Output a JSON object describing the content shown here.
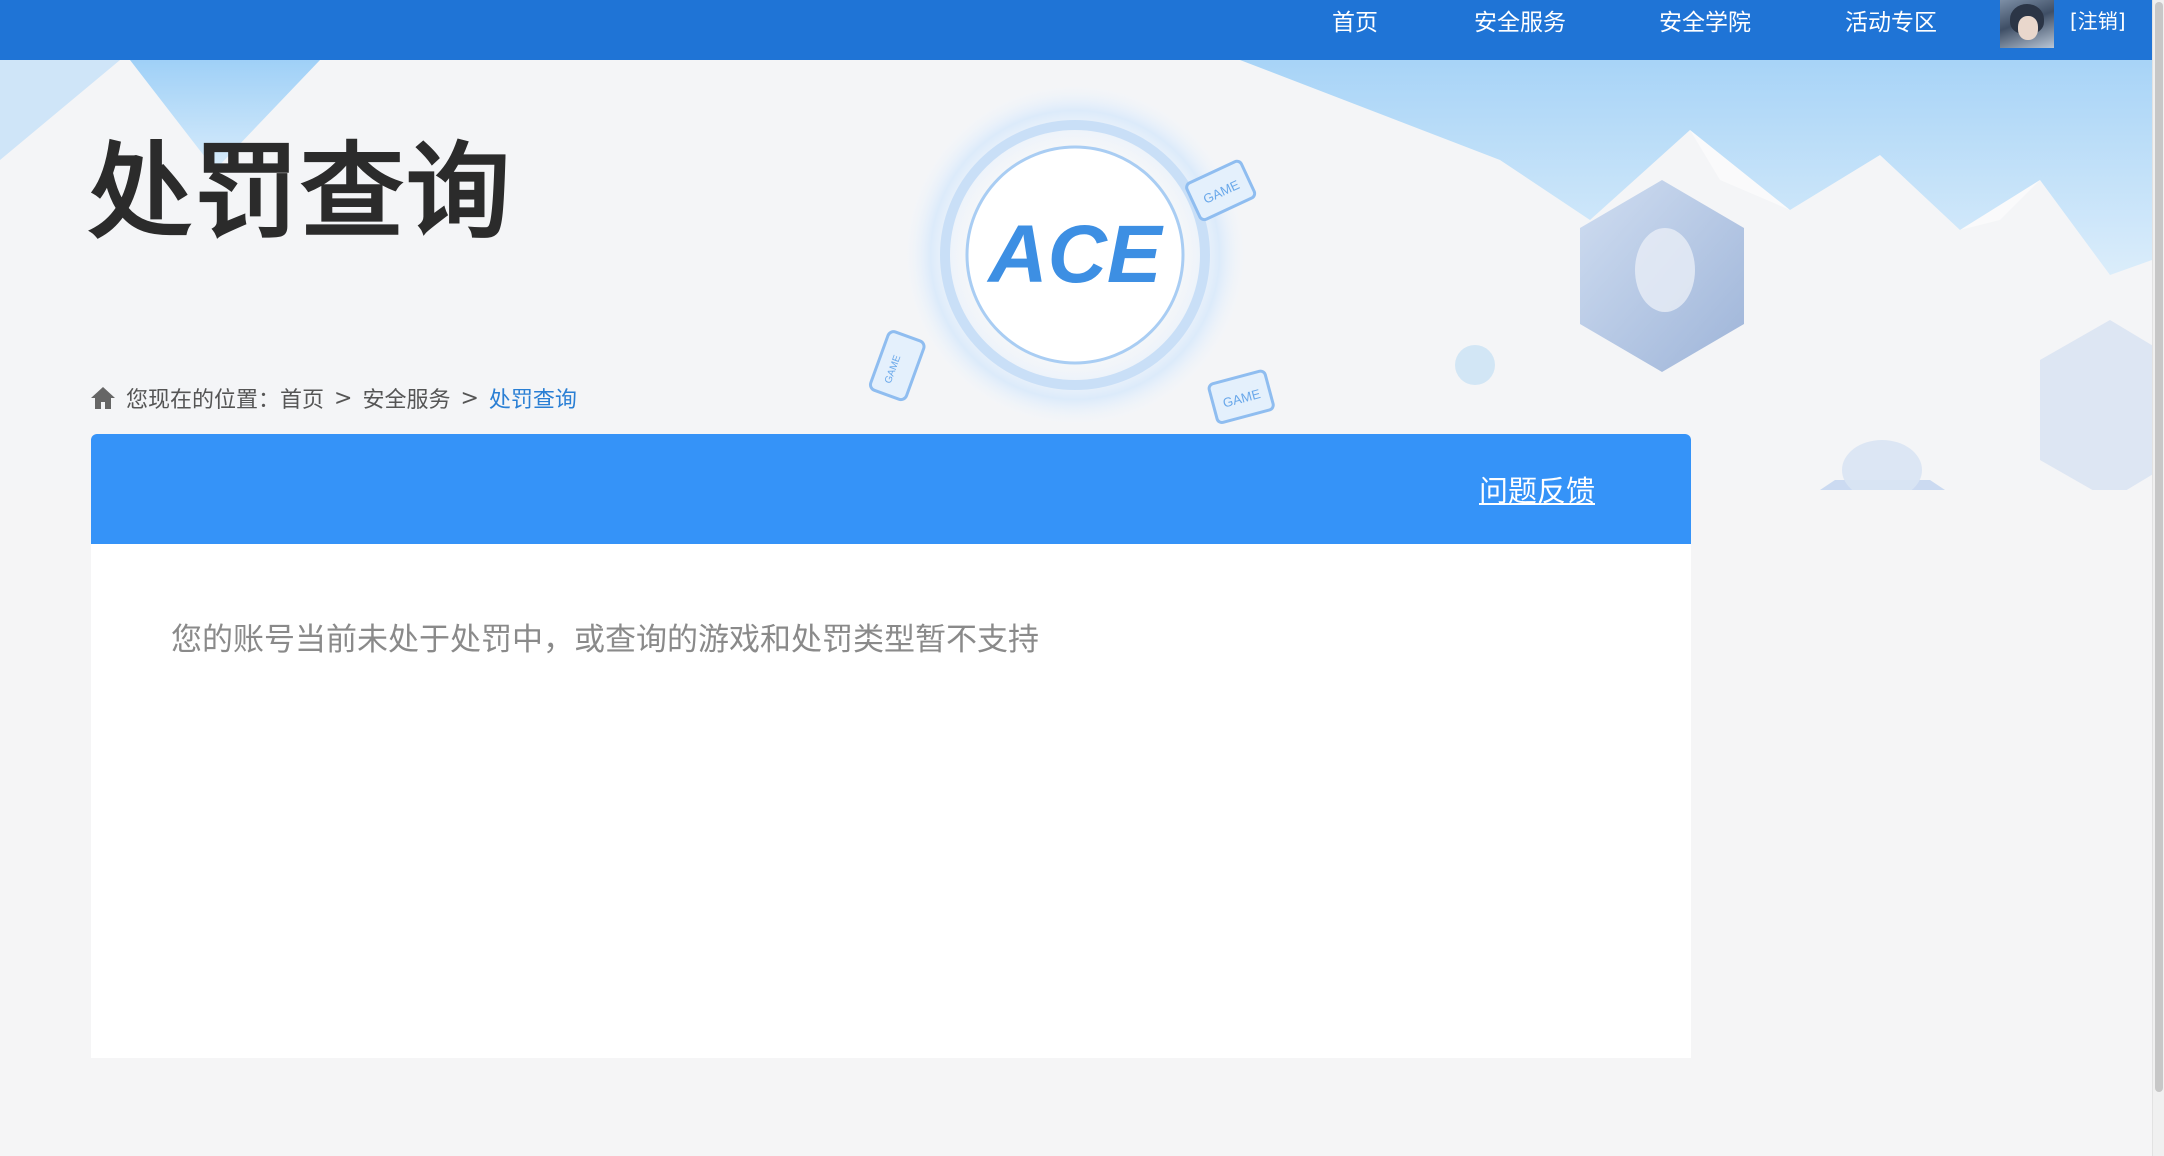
{
  "nav": {
    "items": [
      {
        "label": "首页"
      },
      {
        "label": "安全服务"
      },
      {
        "label": "安全学院"
      },
      {
        "label": "活动专区"
      }
    ],
    "logout_label": "[注销]"
  },
  "banner": {
    "title": "处罚查询",
    "logo_text": "ACE",
    "badge_text": "GAME"
  },
  "breadcrumb": {
    "prefix": "您现在的位置：",
    "items": [
      "首页",
      "安全服务"
    ],
    "separator": ">",
    "current": "处罚查询"
  },
  "panel": {
    "feedback_label": "问题反馈",
    "message": "您的账号当前未处于处罚中，或查询的游戏和处罚类型暂不支持"
  },
  "colors": {
    "topbar": "#1f74d6",
    "panel_header": "#3593f8",
    "breadcrumb_current": "#2a7fd4",
    "title": "#2b2b2b"
  }
}
